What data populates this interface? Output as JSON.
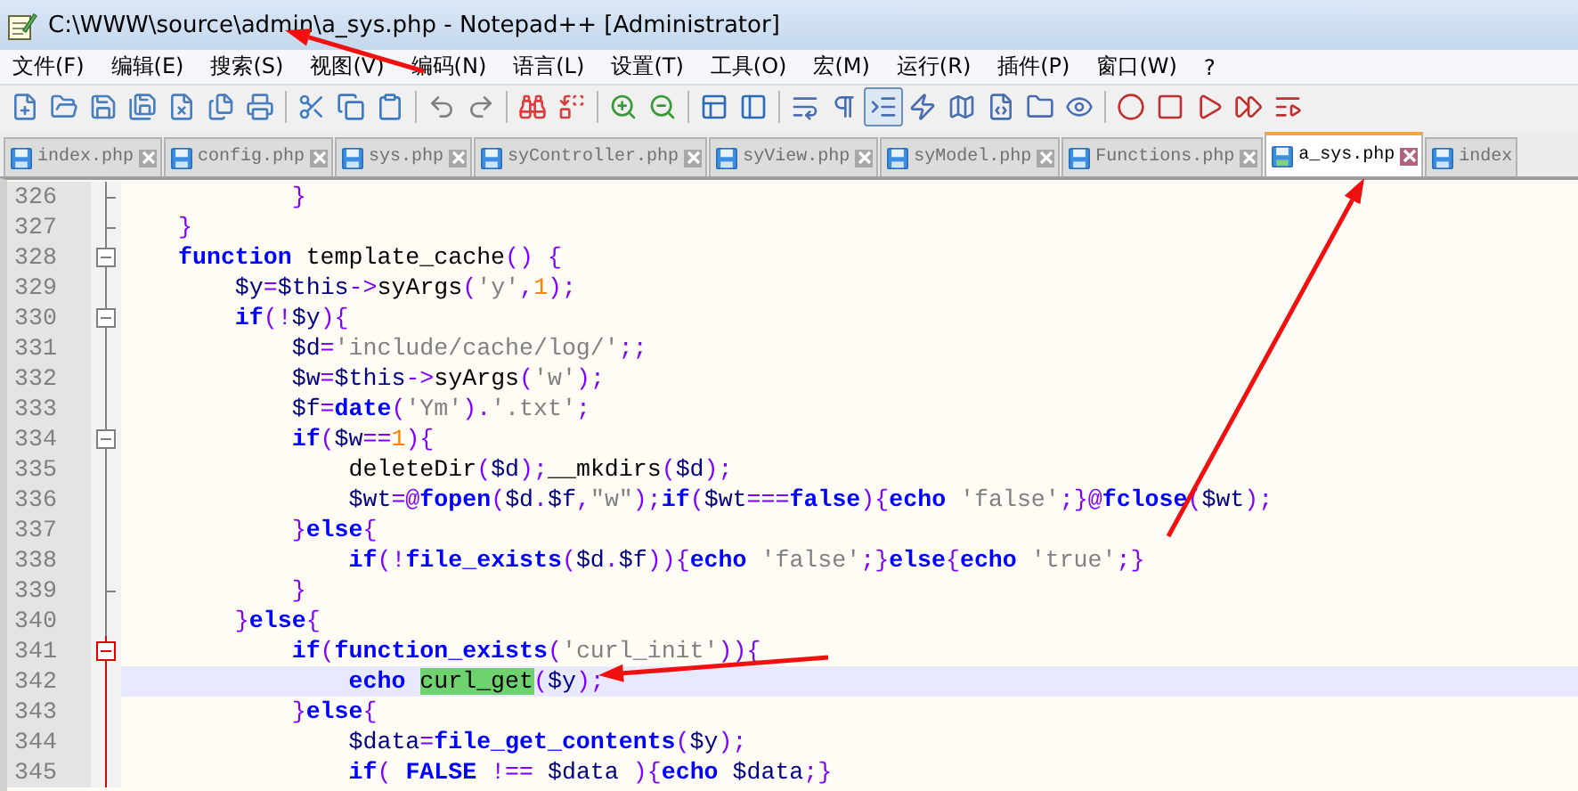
{
  "window": {
    "title": "C:\\WWW\\source\\admin\\a_sys.php - Notepad++ [Administrator]"
  },
  "menu": [
    "文件(F)",
    "编辑(E)",
    "搜索(S)",
    "视图(V)",
    "编码(N)",
    "语言(L)",
    "设置(T)",
    "工具(O)",
    "宏(M)",
    "运行(R)",
    "插件(P)",
    "窗口(W)",
    "?"
  ],
  "toolbar": [
    [
      {
        "pressed": false
      },
      {
        "pressed": false
      },
      {
        "pressed": false
      },
      {
        "pressed": false
      },
      {
        "pressed": false
      },
      {
        "pressed": false
      },
      {
        "pressed": false
      }
    ],
    [
      {
        "pressed": false
      },
      {
        "pressed": false
      },
      {
        "pressed": false
      }
    ],
    [
      {
        "pressed": false
      },
      {
        "pressed": false
      }
    ],
    [
      {
        "pressed": false
      },
      {
        "pressed": false
      }
    ],
    [
      {
        "pressed": false
      },
      {
        "pressed": false
      }
    ],
    [
      {
        "pressed": false
      },
      {
        "pressed": false
      }
    ],
    [
      {
        "pressed": false
      },
      {
        "pressed": false
      },
      {
        "pressed": true
      },
      {
        "pressed": false
      },
      {
        "pressed": false
      },
      {
        "pressed": false
      },
      {
        "pressed": false
      },
      {
        "pressed": false
      }
    ],
    [
      {
        "pressed": false
      },
      {
        "pressed": false
      },
      {
        "pressed": false
      },
      {
        "pressed": false
      },
      {
        "pressed": false
      }
    ]
  ],
  "tabs": [
    {
      "label": "index.php",
      "selected": false
    },
    {
      "label": "config.php",
      "selected": false
    },
    {
      "label": "sys.php",
      "selected": false
    },
    {
      "label": "syController.php",
      "selected": false
    },
    {
      "label": "syView.php",
      "selected": false
    },
    {
      "label": "syModel.php",
      "selected": false
    },
    {
      "label": "Functions.php",
      "selected": false
    },
    {
      "label": "a_sys.php",
      "selected": true
    },
    {
      "label": "index",
      "selected": false
    }
  ],
  "editor": {
    "lines": [
      {
        "number": "326",
        "kind": "fold-end",
        "active": false,
        "current": false,
        "tokens": [
          {
            "t": "        }",
            "kind": "op"
          }
        ]
      },
      {
        "number": "327",
        "kind": "fold-end",
        "active": false,
        "current": false,
        "tokens": [
          {
            "t": "}",
            "kind": "op"
          }
        ]
      },
      {
        "number": "328",
        "kind": "fold-start",
        "active": false,
        "current": false,
        "tokens": [
          {
            "t": "function",
            "kind": "kw"
          },
          {
            "t": " template_cache",
            "kind": "plain"
          },
          {
            "t": "() {",
            "kind": "op"
          }
        ]
      },
      {
        "number": "329",
        "kind": "fold-line",
        "active": false,
        "current": false,
        "tokens": [
          {
            "t": "    $y",
            "kind": "var"
          },
          {
            "t": "=",
            "kind": "op"
          },
          {
            "t": "$this",
            "kind": "var"
          },
          {
            "t": "->",
            "kind": "op"
          },
          {
            "t": "syArgs",
            "kind": "plain"
          },
          {
            "t": "(",
            "kind": "op"
          },
          {
            "t": "'y'",
            "kind": "str"
          },
          {
            "t": ",",
            "kind": "op"
          },
          {
            "t": "1",
            "kind": "num"
          },
          {
            "t": ");",
            "kind": "op"
          }
        ]
      },
      {
        "number": "330",
        "kind": "fold-start",
        "active": false,
        "current": false,
        "tokens": [
          {
            "t": "    if",
            "kind": "kw"
          },
          {
            "t": "(!",
            "kind": "op"
          },
          {
            "t": "$y",
            "kind": "var"
          },
          {
            "t": "){",
            "kind": "op"
          }
        ]
      },
      {
        "number": "331",
        "kind": "fold-line",
        "active": false,
        "current": false,
        "tokens": [
          {
            "t": "        $d",
            "kind": "var"
          },
          {
            "t": "=",
            "kind": "op"
          },
          {
            "t": "'include/cache/log/'",
            "kind": "str"
          },
          {
            "t": ";;",
            "kind": "op"
          }
        ]
      },
      {
        "number": "332",
        "kind": "fold-line",
        "active": false,
        "current": false,
        "tokens": [
          {
            "t": "        $w",
            "kind": "var"
          },
          {
            "t": "=",
            "kind": "op"
          },
          {
            "t": "$this",
            "kind": "var"
          },
          {
            "t": "->",
            "kind": "op"
          },
          {
            "t": "syArgs",
            "kind": "plain"
          },
          {
            "t": "(",
            "kind": "op"
          },
          {
            "t": "'w'",
            "kind": "str"
          },
          {
            "t": ");",
            "kind": "op"
          }
        ]
      },
      {
        "number": "333",
        "kind": "fold-line",
        "active": false,
        "current": false,
        "tokens": [
          {
            "t": "        $f",
            "kind": "var"
          },
          {
            "t": "=",
            "kind": "op"
          },
          {
            "t": "date",
            "kind": "fn"
          },
          {
            "t": "(",
            "kind": "op"
          },
          {
            "t": "'Ym'",
            "kind": "str"
          },
          {
            "t": ").",
            "kind": "op"
          },
          {
            "t": "'.txt'",
            "kind": "str"
          },
          {
            "t": ";",
            "kind": "op"
          }
        ]
      },
      {
        "number": "334",
        "kind": "fold-start",
        "active": false,
        "current": false,
        "tokens": [
          {
            "t": "        if",
            "kind": "kw"
          },
          {
            "t": "(",
            "kind": "op"
          },
          {
            "t": "$w",
            "kind": "var"
          },
          {
            "t": "==",
            "kind": "op"
          },
          {
            "t": "1",
            "kind": "num"
          },
          {
            "t": "){",
            "kind": "op"
          }
        ]
      },
      {
        "number": "335",
        "kind": "fold-line",
        "active": false,
        "current": false,
        "tokens": [
          {
            "t": "            deleteDir",
            "kind": "plain"
          },
          {
            "t": "(",
            "kind": "op"
          },
          {
            "t": "$d",
            "kind": "var"
          },
          {
            "t": ");",
            "kind": "op"
          },
          {
            "t": "__mkdirs",
            "kind": "plain"
          },
          {
            "t": "(",
            "kind": "op"
          },
          {
            "t": "$d",
            "kind": "var"
          },
          {
            "t": ");",
            "kind": "op"
          }
        ]
      },
      {
        "number": "336",
        "kind": "fold-line",
        "active": false,
        "current": false,
        "tokens": [
          {
            "t": "            $wt",
            "kind": "var"
          },
          {
            "t": "=@",
            "kind": "op"
          },
          {
            "t": "fopen",
            "kind": "fn"
          },
          {
            "t": "(",
            "kind": "op"
          },
          {
            "t": "$d",
            "kind": "var"
          },
          {
            "t": ".",
            "kind": "op"
          },
          {
            "t": "$f",
            "kind": "var"
          },
          {
            "t": ",",
            "kind": "op"
          },
          {
            "t": "\"w\"",
            "kind": "str"
          },
          {
            "t": ");",
            "kind": "op"
          },
          {
            "t": "if",
            "kind": "kw"
          },
          {
            "t": "(",
            "kind": "op"
          },
          {
            "t": "$wt",
            "kind": "var"
          },
          {
            "t": "===",
            "kind": "op"
          },
          {
            "t": "false",
            "kind": "kw"
          },
          {
            "t": "){",
            "kind": "op"
          },
          {
            "t": "echo",
            "kind": "kw"
          },
          {
            "t": " 'false'",
            "kind": "str"
          },
          {
            "t": ";}@",
            "kind": "op"
          },
          {
            "t": "fclose",
            "kind": "fn"
          },
          {
            "t": "(",
            "kind": "op"
          },
          {
            "t": "$wt",
            "kind": "var"
          },
          {
            "t": ");",
            "kind": "op"
          }
        ]
      },
      {
        "number": "337",
        "kind": "fold-line",
        "active": false,
        "current": false,
        "tokens": [
          {
            "t": "        }",
            "kind": "op"
          },
          {
            "t": "else",
            "kind": "kw"
          },
          {
            "t": "{",
            "kind": "op"
          }
        ]
      },
      {
        "number": "338",
        "kind": "fold-line",
        "active": false,
        "current": false,
        "tokens": [
          {
            "t": "            if",
            "kind": "kw"
          },
          {
            "t": "(!",
            "kind": "op"
          },
          {
            "t": "file_exists",
            "kind": "fn"
          },
          {
            "t": "(",
            "kind": "op"
          },
          {
            "t": "$d",
            "kind": "var"
          },
          {
            "t": ".",
            "kind": "op"
          },
          {
            "t": "$f",
            "kind": "var"
          },
          {
            "t": ")){",
            "kind": "op"
          },
          {
            "t": "echo",
            "kind": "kw"
          },
          {
            "t": " 'false'",
            "kind": "str"
          },
          {
            "t": ";}",
            "kind": "op"
          },
          {
            "t": "else",
            "kind": "kw"
          },
          {
            "t": "{",
            "kind": "op"
          },
          {
            "t": "echo",
            "kind": "kw"
          },
          {
            "t": " 'true'",
            "kind": "str"
          },
          {
            "t": ";}",
            "kind": "op"
          }
        ]
      },
      {
        "number": "339",
        "kind": "fold-end",
        "active": false,
        "current": false,
        "tokens": [
          {
            "t": "        }",
            "kind": "op"
          }
        ]
      },
      {
        "number": "340",
        "kind": "fold-line",
        "active": false,
        "current": false,
        "tokens": [
          {
            "t": "    }",
            "kind": "op"
          },
          {
            "t": "else",
            "kind": "kw"
          },
          {
            "t": "{",
            "kind": "op"
          }
        ]
      },
      {
        "number": "341",
        "kind": "fold-start",
        "active": true,
        "current": false,
        "tokens": [
          {
            "t": "        if",
            "kind": "kw"
          },
          {
            "t": "(",
            "kind": "op"
          },
          {
            "t": "function_exists",
            "kind": "fn"
          },
          {
            "t": "(",
            "kind": "op"
          },
          {
            "t": "'curl_init'",
            "kind": "str"
          },
          {
            "t": ")){",
            "kind": "op"
          }
        ]
      },
      {
        "number": "342",
        "kind": "fold-line",
        "active": true,
        "current": true,
        "tokens": [
          {
            "t": "            echo ",
            "kind": "kw"
          },
          {
            "t": "curl_get",
            "kind": "match"
          },
          {
            "t": "(",
            "kind": "op"
          },
          {
            "t": "$y",
            "kind": "var"
          },
          {
            "t": ");",
            "kind": "op"
          }
        ]
      },
      {
        "number": "343",
        "kind": "fold-line",
        "active": true,
        "current": false,
        "tokens": [
          {
            "t": "        }",
            "kind": "op"
          },
          {
            "t": "else",
            "kind": "kw"
          },
          {
            "t": "{",
            "kind": "op"
          }
        ]
      },
      {
        "number": "344",
        "kind": "fold-line",
        "active": true,
        "current": false,
        "tokens": [
          {
            "t": "            $data",
            "kind": "var"
          },
          {
            "t": "=",
            "kind": "op"
          },
          {
            "t": "file_get_contents",
            "kind": "fn"
          },
          {
            "t": "(",
            "kind": "op"
          },
          {
            "t": "$y",
            "kind": "var"
          },
          {
            "t": ");",
            "kind": "op"
          }
        ]
      },
      {
        "number": "345",
        "kind": "fold-line",
        "active": true,
        "current": false,
        "tokens": [
          {
            "t": "            if",
            "kind": "kw"
          },
          {
            "t": "( ",
            "kind": "op"
          },
          {
            "t": "FALSE",
            "kind": "kw"
          },
          {
            "t": " !==",
            "kind": "op"
          },
          {
            "t": " $data",
            "kind": "var"
          },
          {
            "t": " ){",
            "kind": "op"
          },
          {
            "t": "echo",
            "kind": "kw"
          },
          {
            "t": " $data",
            "kind": "var"
          },
          {
            "t": ";}",
            "kind": "op"
          }
        ]
      }
    ]
  }
}
